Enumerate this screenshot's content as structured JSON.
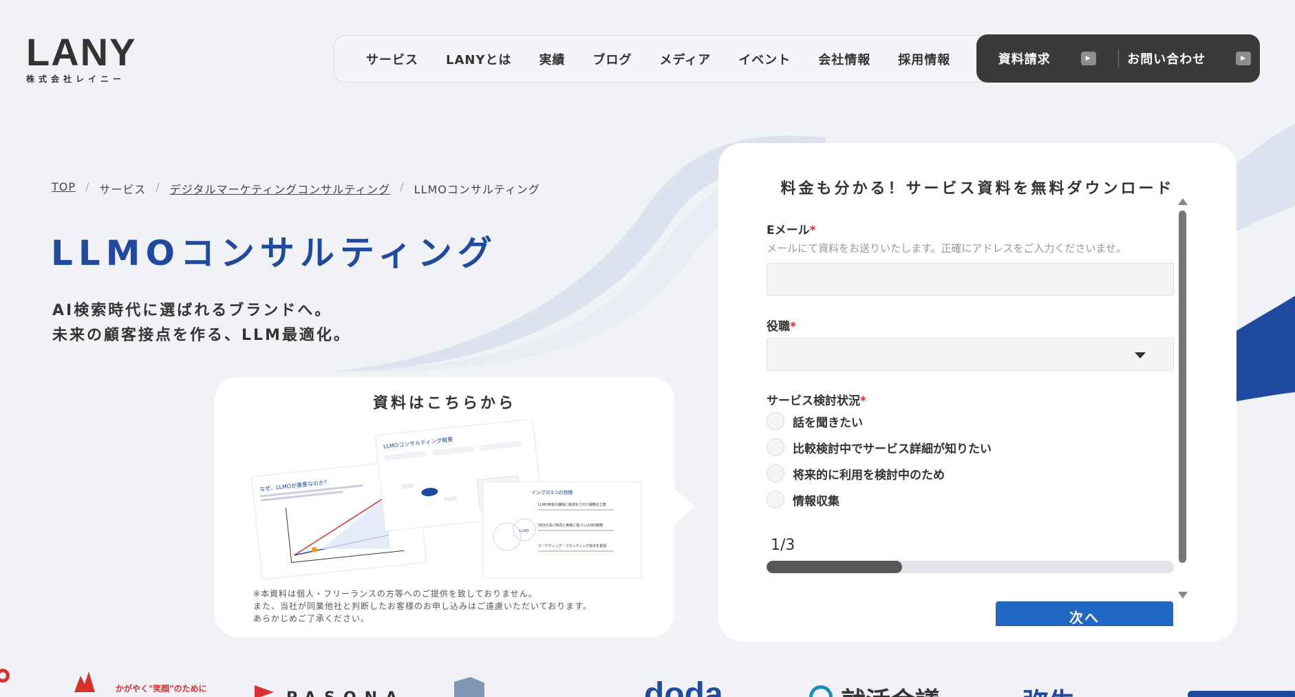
{
  "brand": {
    "name": "LANY",
    "tagline": "株式会社レイニー"
  },
  "nav": {
    "items": [
      "サービス",
      "LANYとは",
      "実績",
      "ブログ",
      "メディア",
      "イベント",
      "会社情報",
      "採用情報"
    ],
    "cta_docs": "資料請求",
    "cta_contact": "お問い合わせ"
  },
  "breadcrumb": [
    "TOP",
    "サービス",
    "デジタルマーケティングコンサルティング",
    "LLMOコンサルティング"
  ],
  "hero": {
    "title": "LLMOコンサルティング",
    "lead_line1": "AI検索時代に選ばれるブランドへ。",
    "lead_line2": "未来の顧客接点を作る、LLM最適化。"
  },
  "doc_card": {
    "title": "資料はこちらから",
    "note_line1": "※本資料は個人・フリーランスの方等へのご提供を致しておりません。",
    "note_line2": "また、当社が同業他社と判断したお客様のお申し込みはご遠慮いただいております。",
    "note_line3": "あらかじめご了承ください。",
    "preview": {
      "slide1_title": "なぜ、LLMOが重要なのか？",
      "slide2_title": "LLMOコンサルティング概要",
      "slide3_title": "イングの3つの特徴",
      "slide3_items": [
        "LLMO特有の課題に最適化された戦略を立案",
        "SEOの深い知見と実績に基づくLLMO戦略",
        "マーケティング・ブランディング視点を重視"
      ],
      "chat_bubble": "LLMO"
    }
  },
  "form": {
    "heading": "料金も分かる！サービス資料を無料ダウンロード",
    "email_label": "Eメール",
    "email_help": "メールにて資料をお送りいたします。正確にアドレスをご入力くださいませ。",
    "email_value": "",
    "role_label": "役職",
    "role_value": "",
    "status_label": "サービス検討状況",
    "status_options": [
      "話を聞きたい",
      "比較検討中でサービス詳細が知りたい",
      "将来的に利用を検討中のため",
      "情報収集"
    ],
    "required_mark": "*",
    "step_text": "1/3",
    "progress": 0.333,
    "next_label": "次へ"
  },
  "client_logos": [
    "かがやく\"笑顔\"のために",
    "PASONA",
    "doda",
    "就活会議",
    "弥生"
  ],
  "colors": {
    "accent": "#1f4aa0",
    "button": "#2168c4",
    "dark": "#3a3a3a"
  }
}
